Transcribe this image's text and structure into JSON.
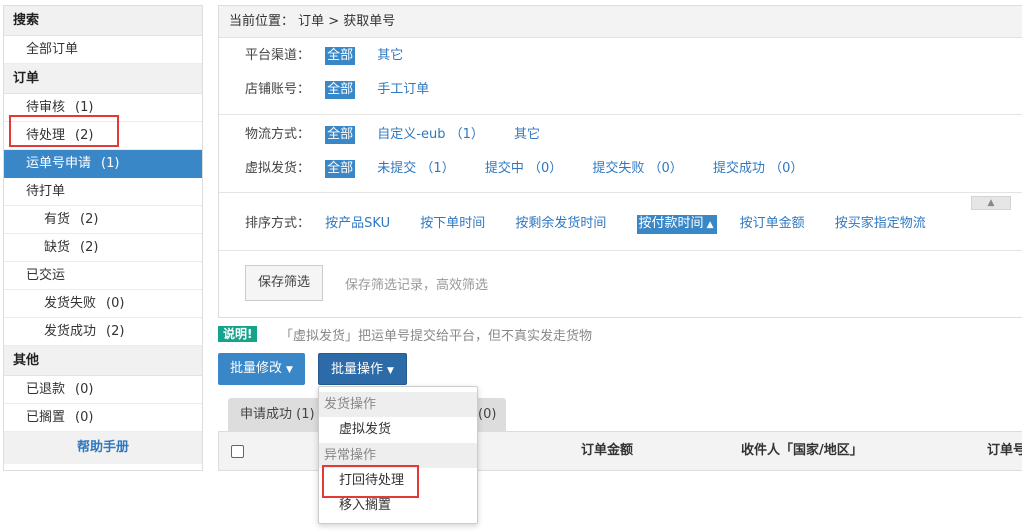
{
  "sidebar": {
    "search_header": "搜索",
    "all_orders": "全部订单",
    "order_header": "订单",
    "items": [
      {
        "label": "待审核",
        "count": "(1)"
      },
      {
        "label": "待处理",
        "count": "(2)"
      },
      {
        "label": "运单号申请",
        "count": "(1)"
      },
      {
        "label": "待打单",
        "count": ""
      },
      {
        "label": "有货",
        "count": "(2)"
      },
      {
        "label": "缺货",
        "count": "(2)"
      },
      {
        "label": "已交运",
        "count": ""
      },
      {
        "label": "发货失败",
        "count": "(0)"
      },
      {
        "label": "发货成功",
        "count": "(2)"
      }
    ],
    "other_header": "其他",
    "other_items": [
      {
        "label": "已退款",
        "count": "(0)"
      },
      {
        "label": "已搁置",
        "count": "(0)"
      }
    ],
    "help": "帮助手册"
  },
  "breadcrumb": "当前位置： 订单 > 获取单号",
  "filters": {
    "platform": {
      "label": "平台渠道：",
      "options": [
        "全部",
        "其它"
      ]
    },
    "store": {
      "label": "店铺账号：",
      "options": [
        "全部",
        "手工订单"
      ]
    },
    "logistics": {
      "label": "物流方式：",
      "options": [
        "全部",
        "自定义-eub （1）",
        "其它"
      ]
    },
    "virtual": {
      "label": "虚拟发货：",
      "options": [
        "全部",
        "未提交 （1）",
        "提交中 （0）",
        "提交失败 （0）",
        "提交成功 （0）"
      ]
    },
    "sort": {
      "label": "排序方式：",
      "options": [
        "按产品SKU",
        "按下单时间",
        "按剩余发货时间",
        "按付款时间",
        "按订单金额",
        "按买家指定物流"
      ]
    }
  },
  "save": {
    "button": "保存筛选",
    "tip": "保存筛选记录，高效筛选"
  },
  "notice": {
    "badge": "说明!",
    "text": "「虚拟发货」把运单号提交给平台，但不真实发走货物"
  },
  "toolbar": {
    "batch_modify": "批量修改",
    "batch_ops": "批量操作"
  },
  "tabs": [
    "申请成功 (1)",
    "(0)"
  ],
  "table": {
    "columns": [
      "订单金额",
      "收件人「国家/地区」",
      "订单号"
    ]
  },
  "dropdown": {
    "group1": "发货操作",
    "item1": "虚拟发货",
    "group2": "异常操作",
    "item2": "打回待处理",
    "item3": "移入搁置"
  }
}
